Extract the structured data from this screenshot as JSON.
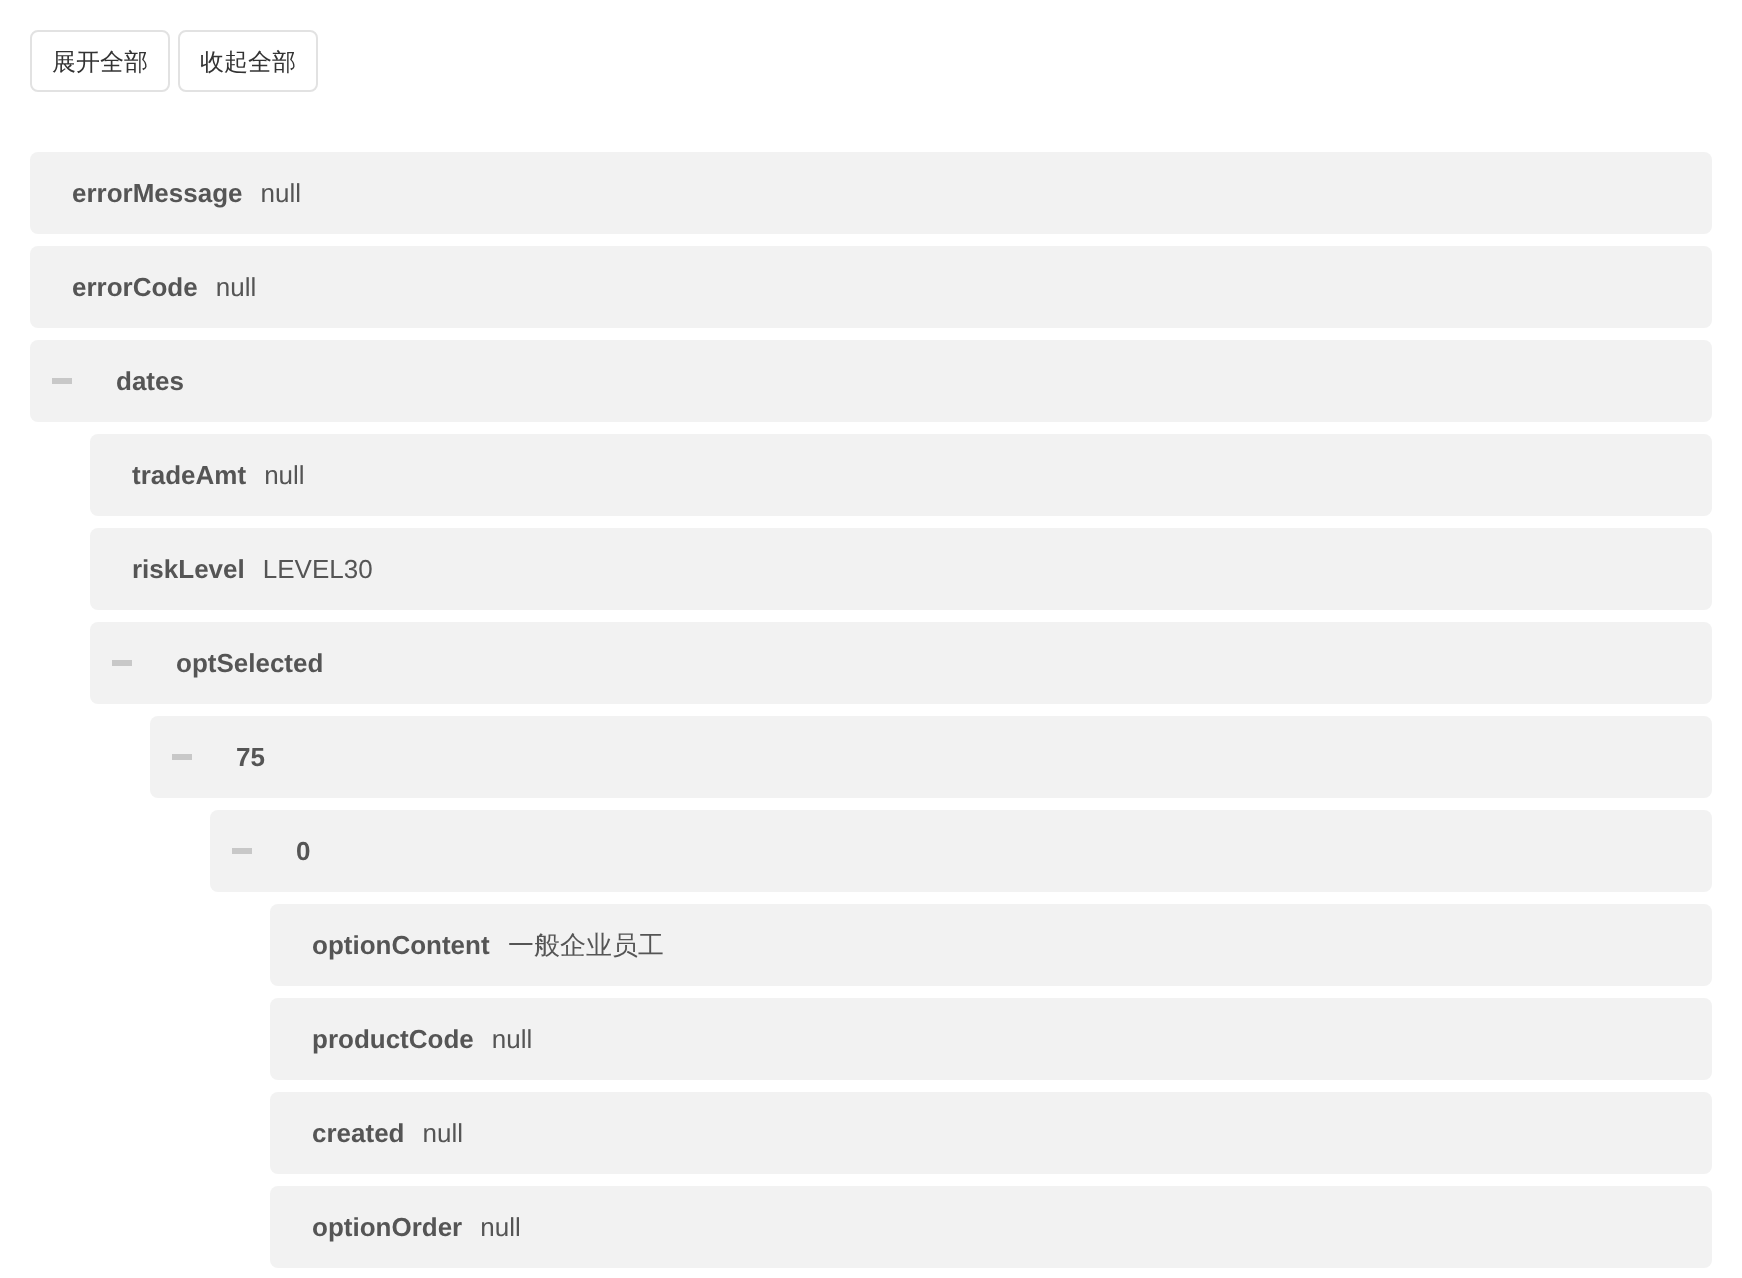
{
  "toolbar": {
    "buttons": [
      "展开全部",
      "收起全部"
    ]
  },
  "tree": [
    {
      "key": "errorMessage",
      "value": "null"
    },
    {
      "key": "errorCode",
      "value": "null"
    },
    {
      "key": "dates",
      "expanded": true,
      "children": [
        {
          "key": "tradeAmt",
          "value": "null"
        },
        {
          "key": "riskLevel",
          "value": "LEVEL30"
        },
        {
          "key": "optSelected",
          "expanded": true,
          "children": [
            {
              "key": "75",
              "expanded": true,
              "children": [
                {
                  "key": "0",
                  "expanded": true,
                  "children": [
                    {
                      "key": "optionContent",
                      "value": "一般企业员工"
                    },
                    {
                      "key": "productCode",
                      "value": "null"
                    },
                    {
                      "key": "created",
                      "value": "null"
                    },
                    {
                      "key": "optionOrder",
                      "value": "null"
                    }
                  ]
                }
              ]
            }
          ]
        }
      ]
    }
  ]
}
